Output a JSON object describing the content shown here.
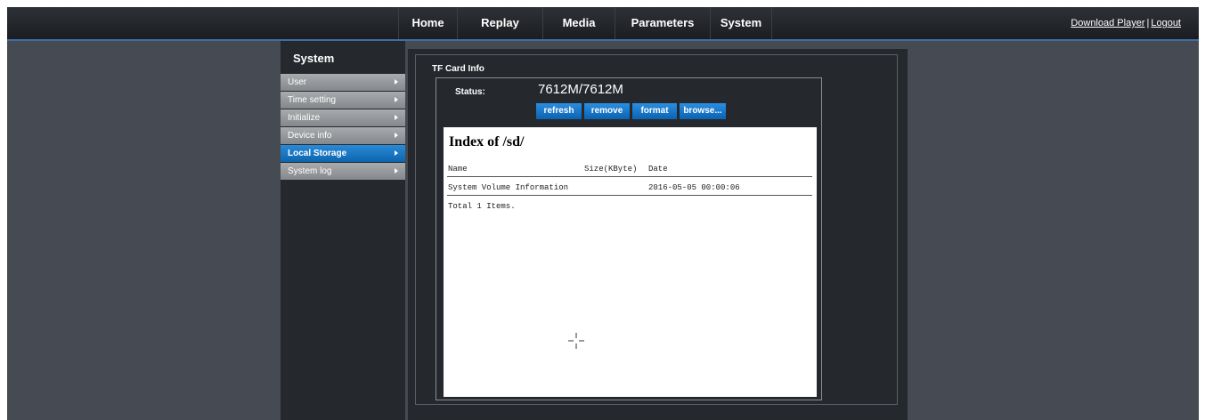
{
  "nav": {
    "items": [
      "Home",
      "Replay",
      "Media",
      "Parameters",
      "System"
    ],
    "download_label": "Download Player",
    "separator": "|",
    "logout_label": "Logout"
  },
  "sidebar": {
    "title": "System",
    "items": [
      {
        "label": "User",
        "active": false
      },
      {
        "label": "Time setting",
        "active": false
      },
      {
        "label": "Initialize",
        "active": false
      },
      {
        "label": "Device info",
        "active": false
      },
      {
        "label": "Local Storage",
        "active": true
      },
      {
        "label": "System log",
        "active": false
      }
    ]
  },
  "tfcard": {
    "title": "TF Card Info",
    "status_label": "Status:",
    "status_value": "7612M/7612M",
    "buttons": {
      "refresh": "refresh",
      "remove": "remove",
      "format": "format",
      "browse": "browse..."
    }
  },
  "listing": {
    "heading": "Index of /sd/",
    "columns": {
      "name": "Name",
      "size": "Size(KByte)",
      "date": "Date"
    },
    "rows": [
      {
        "name": "System Volume Information",
        "size": "",
        "date": "2016-05-05 00:00:06"
      }
    ],
    "footer": "Total 1 Items."
  },
  "colors": {
    "accent": "#0c65ae",
    "page_bg": "#464a52",
    "panel_bg": "#25282d"
  }
}
